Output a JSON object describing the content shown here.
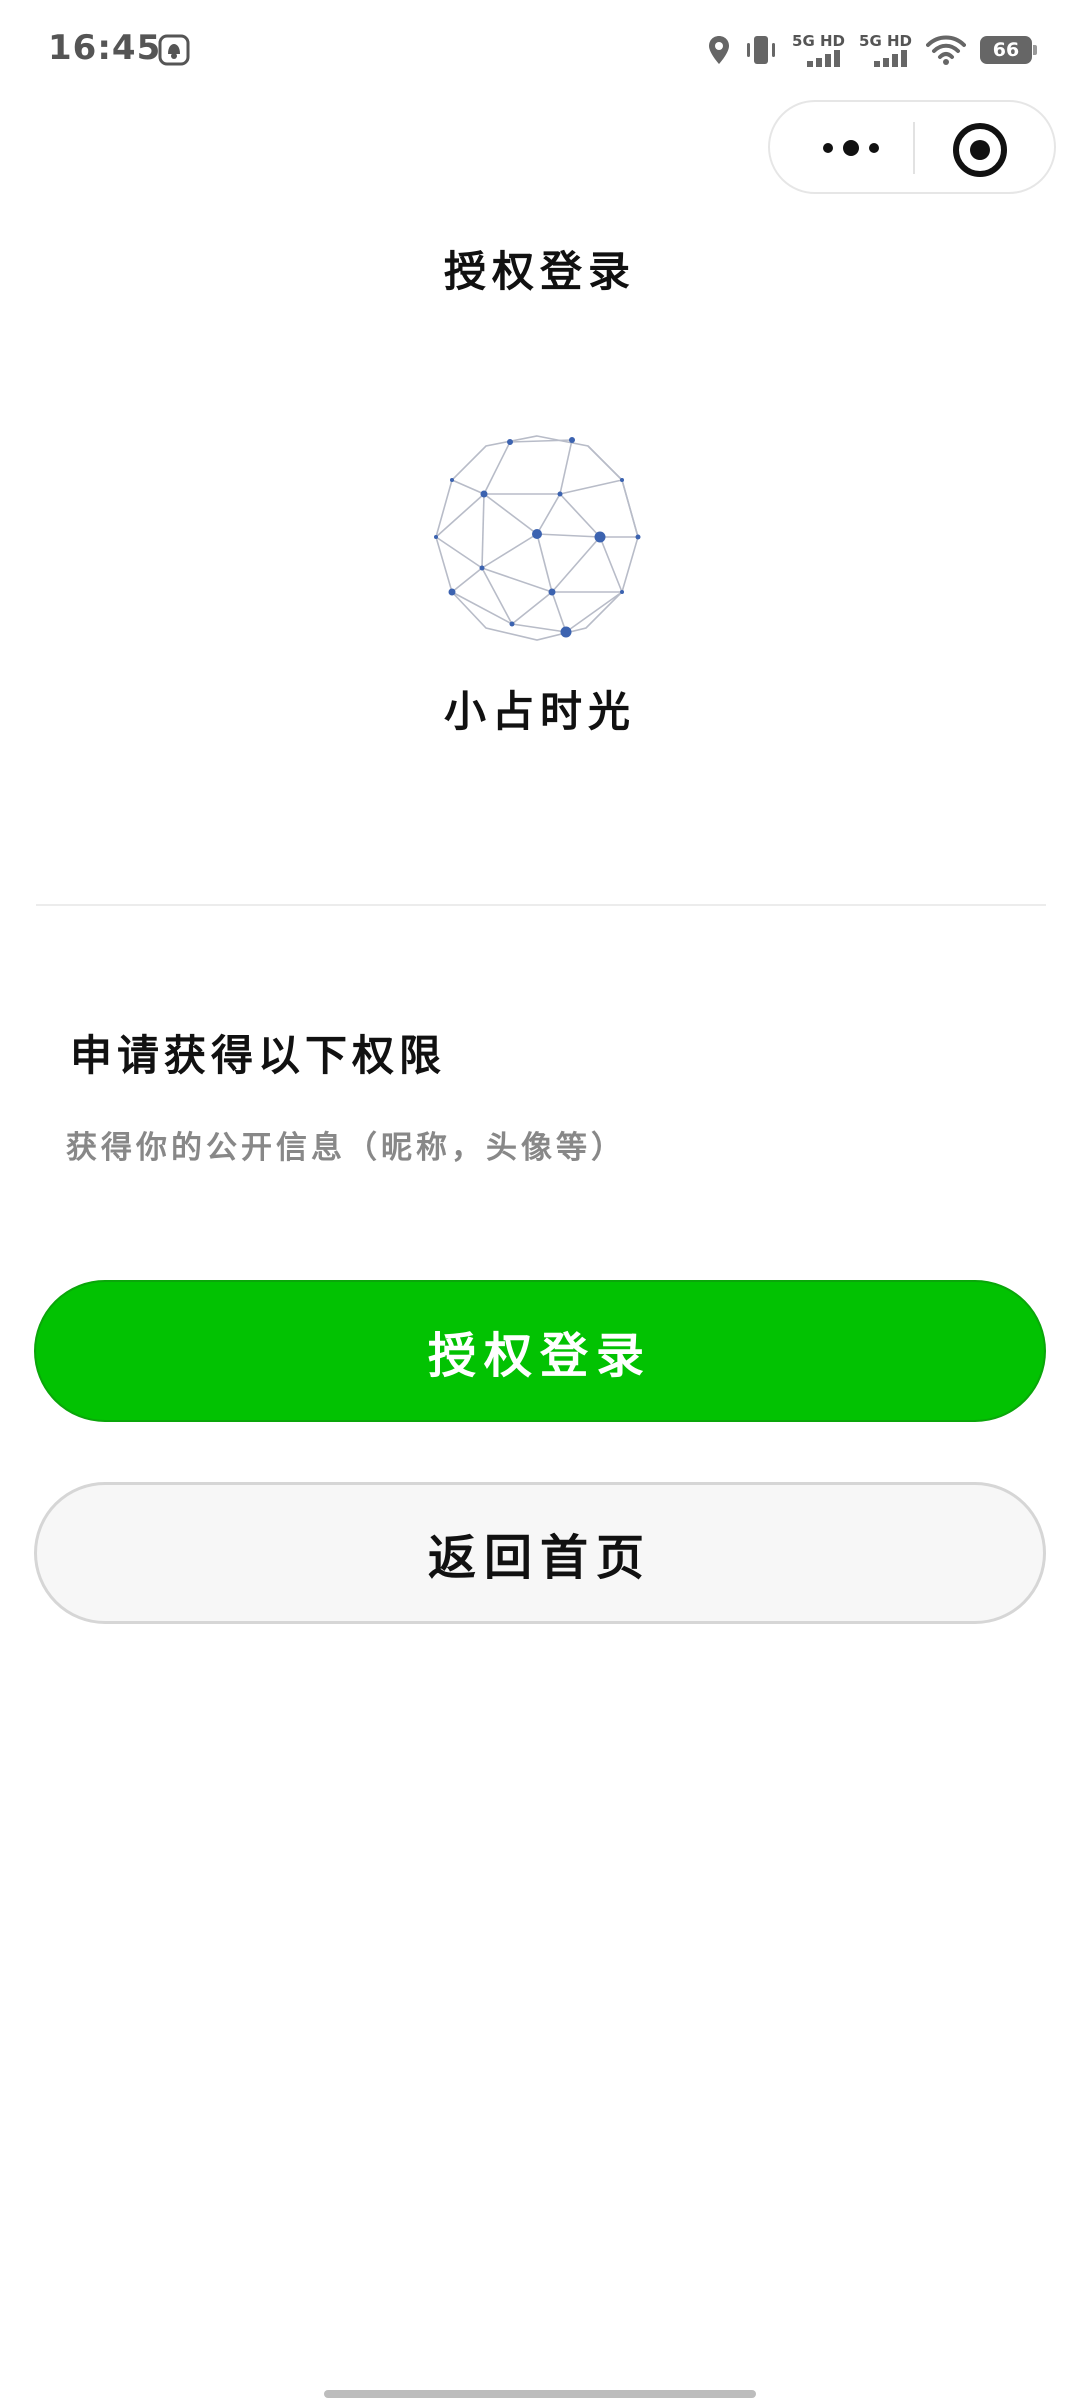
{
  "status_bar": {
    "time": "16:45",
    "network_1": "5G HD",
    "network_2": "5G HD",
    "battery": "66"
  },
  "page": {
    "title": "授权登录"
  },
  "app": {
    "name": "小占时光",
    "logo_icon": "network-globe-icon"
  },
  "permissions": {
    "heading": "申请获得以下权限",
    "description": "获得你的公开信息（昵称，头像等）"
  },
  "buttons": {
    "authorize_label": "授权登录",
    "home_label": "返回首页"
  },
  "colors": {
    "primary": "#02c202",
    "secondary_bg": "#f7f7f7",
    "description_text": "#888888"
  }
}
